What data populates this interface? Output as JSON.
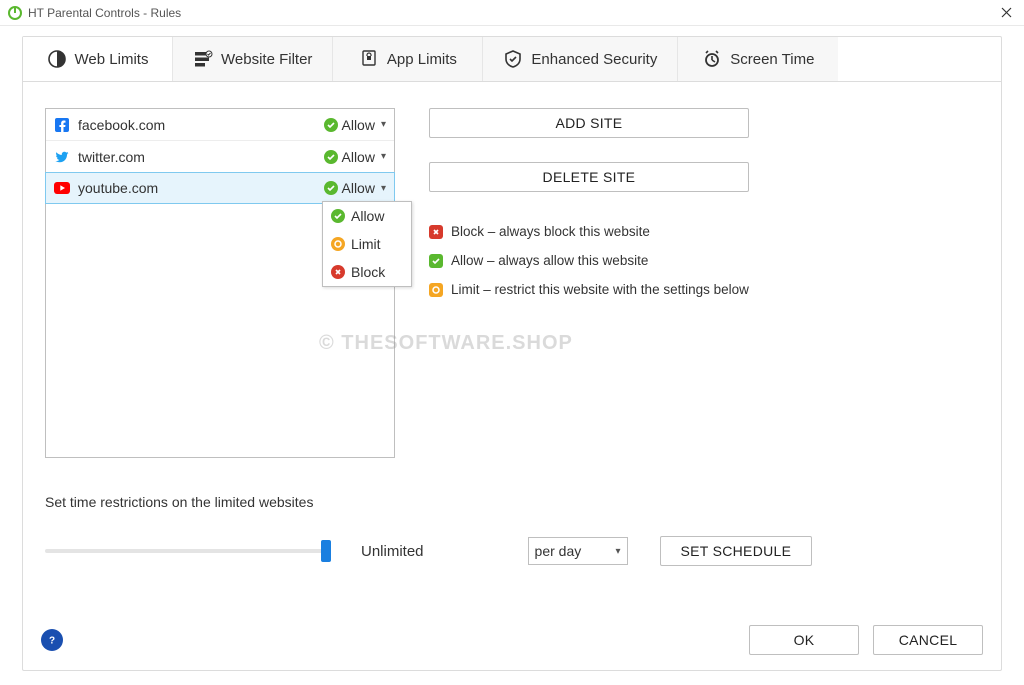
{
  "window": {
    "title": "HT Parental Controls - Rules"
  },
  "tabs": {
    "web_limits": "Web Limits",
    "website_filter": "Website Filter",
    "app_limits": "App Limits",
    "enhanced_security": "Enhanced Security",
    "screen_time": "Screen Time"
  },
  "sites": [
    {
      "name": "facebook.com",
      "status": "Allow"
    },
    {
      "name": "twitter.com",
      "status": "Allow"
    },
    {
      "name": "youtube.com",
      "status": "Allow"
    }
  ],
  "menu": {
    "allow": "Allow",
    "limit": "Limit",
    "block": "Block"
  },
  "buttons": {
    "add_site": "ADD SITE",
    "delete_site": "DELETE SITE",
    "set_schedule": "SET SCHEDULE",
    "ok": "OK",
    "cancel": "CANCEL"
  },
  "legend": {
    "block": "Block – always block this website",
    "allow": "Allow – always allow this website",
    "limit": "Limit – restrict this website with the settings below"
  },
  "limits": {
    "section_label": "Set time restrictions on the limited websites",
    "value_label": "Unlimited",
    "unit_selected": "per day"
  },
  "watermark": "© THESOFTWARE.SHOP"
}
